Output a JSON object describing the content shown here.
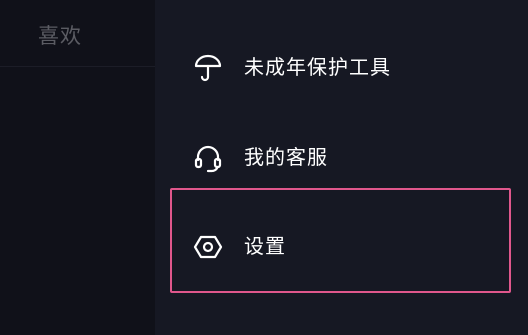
{
  "left_panel": {
    "tab_label": "喜欢"
  },
  "menu": {
    "items": [
      {
        "label": "未成年保护工具",
        "icon": "umbrella-icon"
      },
      {
        "label": "我的客服",
        "icon": "headset-icon"
      },
      {
        "label": "设置",
        "icon": "hexagon-settings-icon"
      }
    ]
  },
  "colors": {
    "background": "#161823",
    "left_panel_bg": "#101119",
    "text": "#ffffff",
    "muted_text": "#5b5c63",
    "highlight": "#e0578c"
  }
}
